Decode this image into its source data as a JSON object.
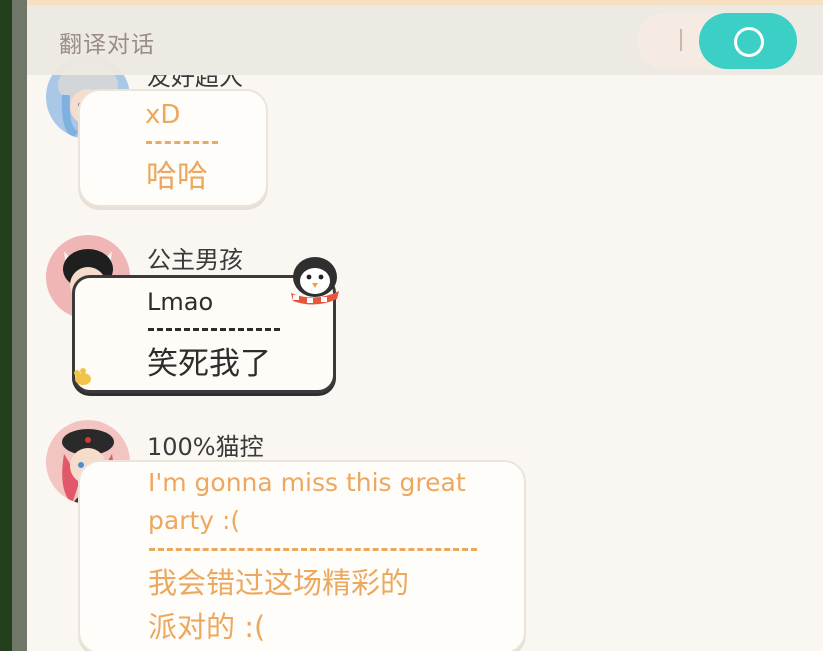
{
  "header": {
    "title": "翻译对话",
    "toggle_on": true
  },
  "colors": {
    "accent": "#3ccfc5",
    "translation_orange": "#eba85e",
    "text_dark": "#2d2d2d"
  },
  "messages": [
    {
      "sender": "友好超人",
      "original": "xD",
      "translation": "哈哈",
      "bubble": "plain"
    },
    {
      "sender": "公主男孩",
      "original": "Lmao",
      "translation": "笑死我了",
      "bubble": "penguin-frame"
    },
    {
      "sender": "100%猫控",
      "original_lines": [
        "I'm gonna miss this great",
        "party :("
      ],
      "translation_lines": [
        "我会错过这场精彩的",
        "派对的 :("
      ],
      "bubble": "plain"
    }
  ]
}
